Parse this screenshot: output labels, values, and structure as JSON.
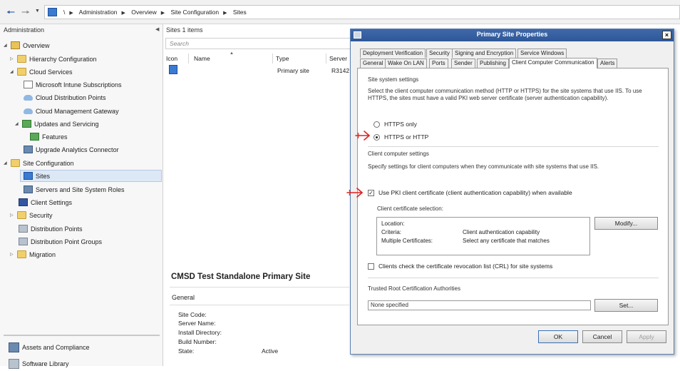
{
  "breadcrumb": [
    "\\",
    "Administration",
    "Overview",
    "Site Configuration",
    "Sites"
  ],
  "nav": {
    "title": "Administration",
    "items": [
      {
        "label": "Overview"
      },
      {
        "label": "Hierarchy Configuration"
      },
      {
        "label": "Cloud Services"
      },
      {
        "label": "Microsoft Intune Subscriptions"
      },
      {
        "label": "Cloud Distribution Points"
      },
      {
        "label": "Cloud Management Gateway"
      },
      {
        "label": "Updates and Servicing"
      },
      {
        "label": "Features"
      },
      {
        "label": "Upgrade Analytics Connector"
      },
      {
        "label": "Site Configuration"
      },
      {
        "label": "Sites"
      },
      {
        "label": "Servers and Site System Roles"
      },
      {
        "label": "Client Settings"
      },
      {
        "label": "Security"
      },
      {
        "label": "Distribution Points"
      },
      {
        "label": "Distribution Point Groups"
      },
      {
        "label": "Migration"
      }
    ],
    "workspaces": [
      {
        "label": "Assets and Compliance"
      },
      {
        "label": "Software Library"
      }
    ]
  },
  "list": {
    "title": "Sites 1 items",
    "search_placeholder": "Search",
    "columns": [
      "Icon",
      "Name",
      "Type",
      "Server"
    ],
    "rows": [
      {
        "name": "",
        "type": "Primary site",
        "server": "R3142"
      }
    ]
  },
  "details": {
    "title": "CMSD Test Standalone Primary Site",
    "section": "General",
    "fields": [
      {
        "label": "Site Code:",
        "value": ""
      },
      {
        "label": "Server Name:",
        "value": ""
      },
      {
        "label": "Install Directory:",
        "value": ""
      },
      {
        "label": "Build Number:",
        "value": ""
      },
      {
        "label": "State:",
        "value": "Active"
      }
    ]
  },
  "dialog": {
    "title": "Primary Site Properties",
    "close_glyph": "×",
    "tabs_row1": [
      "Deployment Verification",
      "Security",
      "Signing and Encryption",
      "Service Windows"
    ],
    "tabs_row2": [
      "General",
      "Wake On LAN",
      "Ports",
      "Sender",
      "Publishing",
      "Client Computer Communication",
      "Alerts"
    ],
    "active_tab": "Client Computer Communication",
    "site_system_settings": {
      "header": "Site system settings",
      "description": "Select the client computer communication method (HTTP or HTTPS) for the site systems that use IIS. To use HTTPS, the sites must have a valid PKI web server certificate (server authentication capability).",
      "options": [
        {
          "label": "HTTPS only",
          "selected": false
        },
        {
          "label": "HTTPS or HTTP",
          "selected": true
        }
      ]
    },
    "client_computer_settings": {
      "header": "Client computer settings",
      "description": "Specify settings for client computers when they communicate with site systems that use IIS.",
      "use_pki_label": "Use PKI client certificate (client authentication capability) when available",
      "use_pki_checked": true,
      "cert_selection_label": "Client certificate selection:",
      "cert_rows": [
        {
          "key": "Location:",
          "value": ""
        },
        {
          "key": "Criteria:",
          "value": "Client authentication capability"
        },
        {
          "key": "Multiple Certificates:",
          "value": "Select any certificate that matches"
        }
      ],
      "modify_label": "Modify...",
      "crl_label": "Clients check the certificate revocation list (CRL) for site systems",
      "crl_checked": false
    },
    "trusted_root": {
      "header": "Trusted Root Certification Authorities",
      "value": "None specified",
      "set_label": "Set..."
    },
    "buttons": {
      "ok": "OK",
      "cancel": "Cancel",
      "apply": "Apply"
    }
  },
  "colors": {
    "accent": "#2d5799",
    "annotation": "#e02020",
    "selection": "#dde8f6"
  }
}
